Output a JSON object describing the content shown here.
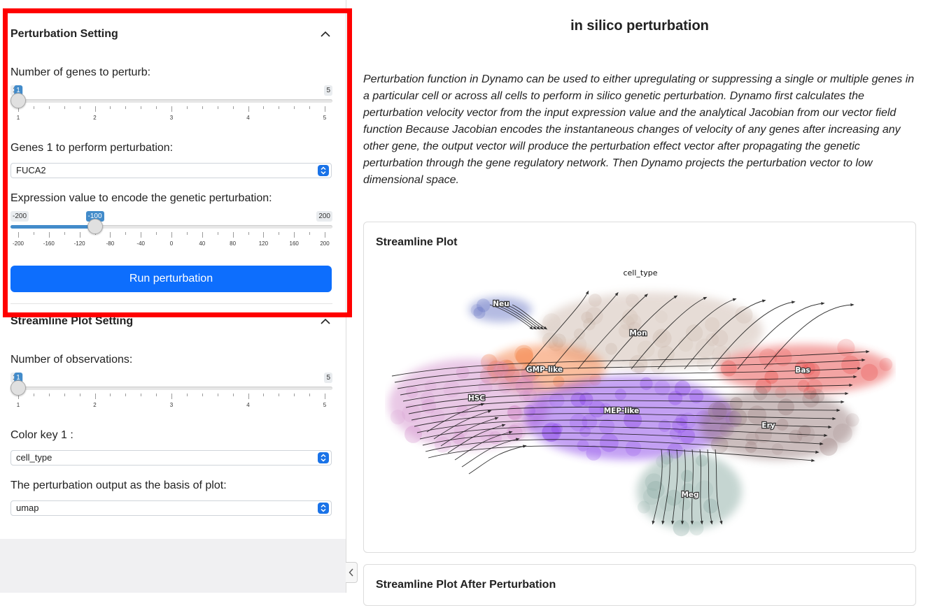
{
  "perturbation_section": {
    "title": "Perturbation Setting",
    "num_genes_label": "Number of genes to perturb:",
    "num_genes_slider": {
      "min": 1,
      "max": 5,
      "value": 1,
      "tick_labels": [
        "1",
        "2",
        "3",
        "4",
        "5"
      ],
      "min_label": "1",
      "max_label": "5",
      "value_label": "1"
    },
    "genes_label": "Genes 1 to perform perturbation:",
    "genes_select_value": "FUCA2",
    "expression_label": "Expression value to encode the genetic perturbation:",
    "expression_slider": {
      "min": -200,
      "max": 200,
      "value": -100,
      "tick_labels": [
        "-200",
        "-160",
        "-120",
        "-80",
        "-40",
        "0",
        "40",
        "80",
        "120",
        "160",
        "200"
      ],
      "min_label": "-200",
      "max_label": "200",
      "value_label": "-100"
    },
    "run_button_label": "Run perturbation"
  },
  "streamline_section": {
    "title": "Streamline Plot Setting",
    "num_obs_label": "Number of observations:",
    "num_obs_slider": {
      "min": 1,
      "max": 5,
      "value": 1,
      "tick_labels": [
        "1",
        "2",
        "3",
        "4",
        "5"
      ],
      "min_label": "1",
      "max_label": "5",
      "value_label": "1"
    },
    "color_key_label": "Color key 1 :",
    "color_key_value": "cell_type",
    "basis_label": "The perturbation output as the basis of plot:",
    "basis_value": "umap"
  },
  "main": {
    "title": "in silico perturbation",
    "description": "Perturbation function in Dynamo can be used to either upregulating or suppressing a single or multiple genes in a particular cell or across all cells to perform in silico genetic perturbation. Dynamo first calculates the perturbation velocity vector from the input expression value and the analytical Jacobian from our vector field function Because Jacobian encodes the instantaneous changes of velocity of any genes after increasing any other gene, the output vector will produce the perturbation effect vector after propagating the genetic perturbation through the gene regulatory network. Then Dynamo projects the perturbation vector to low dimensional space.",
    "card1_title": "Streamline Plot",
    "card2_title": "Streamline Plot After Perturbation"
  },
  "toggle_icon": "chevron-left-icon",
  "colors": {
    "accent": "#0d6efd",
    "slider_active": "#428bca",
    "highlight": "#ff0000",
    "Neu": "#5c6bc0",
    "Mon": "#c9b2a6",
    "GMP-like": "#f4702a",
    "HSC": "#cf86c8",
    "MEP-like": "#7b2ee6",
    "Bas": "#e53935",
    "Ery": "#8d6e6e",
    "Meg": "#7fa39a"
  },
  "chart_data": {
    "type": "scatter",
    "title": "cell_type",
    "clusters": [
      {
        "name": "Neu",
        "color": "#5c6bc0"
      },
      {
        "name": "Mon",
        "color": "#c9b2a6"
      },
      {
        "name": "GMP-like",
        "color": "#f4702a"
      },
      {
        "name": "HSC",
        "color": "#cf86c8"
      },
      {
        "name": "MEP-like",
        "color": "#7b2ee6"
      },
      {
        "name": "Bas",
        "color": "#e53935"
      },
      {
        "name": "Ery",
        "color": "#8d6e6e"
      },
      {
        "name": "Meg",
        "color": "#7fa39a"
      }
    ],
    "overlay": "streamlines",
    "axes": "off",
    "legend": "on-data labels"
  }
}
